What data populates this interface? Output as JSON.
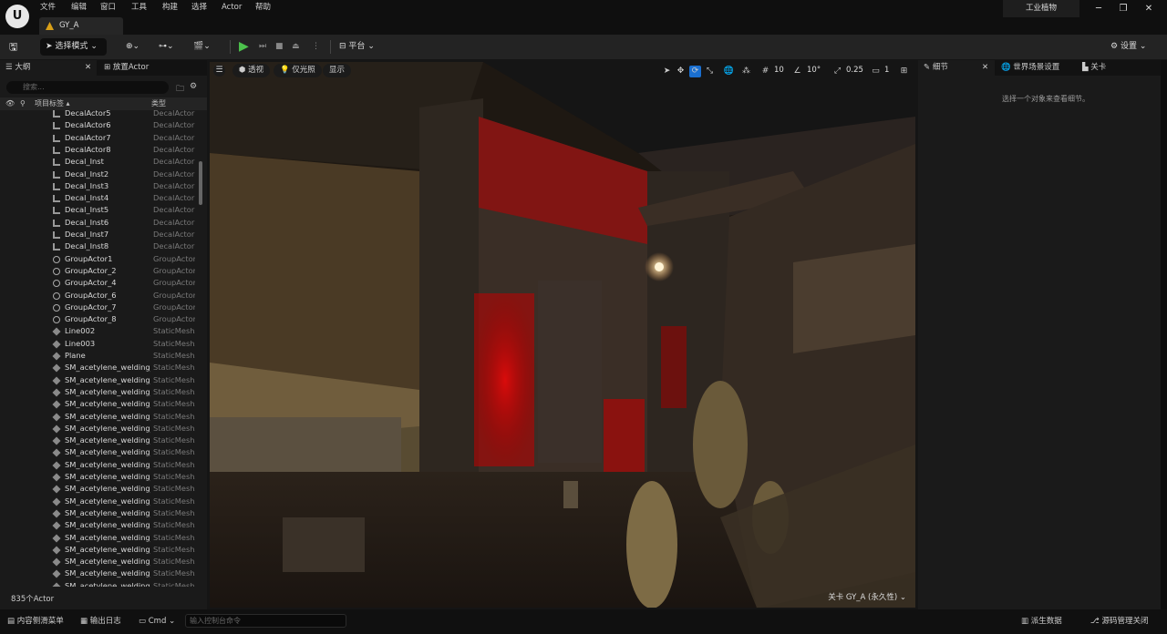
{
  "menu": [
    "文件",
    "编辑",
    "窗口",
    "工具",
    "构建",
    "选择",
    "Actor",
    "帮助"
  ],
  "project_name": "工业植物",
  "document_tab": "GY_A",
  "toolbar": {
    "mode_label": "选择模式",
    "platform_label": "平台",
    "settings_label": "设置"
  },
  "outliner": {
    "tab_label": "大纲",
    "place_actor_label": "放置Actor",
    "search_placeholder": "搜索...",
    "col_label": "项目标签",
    "col_type": "类型",
    "count": "835个Actor",
    "rows": [
      {
        "name": "DecalActor5",
        "type": "DecalActor",
        "icon": "decal"
      },
      {
        "name": "DecalActor6",
        "type": "DecalActor",
        "icon": "decal"
      },
      {
        "name": "DecalActor7",
        "type": "DecalActor",
        "icon": "decal"
      },
      {
        "name": "DecalActor8",
        "type": "DecalActor",
        "icon": "decal"
      },
      {
        "name": "Decal_Inst",
        "type": "DecalActor",
        "icon": "decal"
      },
      {
        "name": "Decal_Inst2",
        "type": "DecalActor",
        "icon": "decal"
      },
      {
        "name": "Decal_Inst3",
        "type": "DecalActor",
        "icon": "decal"
      },
      {
        "name": "Decal_Inst4",
        "type": "DecalActor",
        "icon": "decal"
      },
      {
        "name": "Decal_Inst5",
        "type": "DecalActor",
        "icon": "decal"
      },
      {
        "name": "Decal_Inst6",
        "type": "DecalActor",
        "icon": "decal"
      },
      {
        "name": "Decal_Inst7",
        "type": "DecalActor",
        "icon": "decal"
      },
      {
        "name": "Decal_Inst8",
        "type": "DecalActor",
        "icon": "decal"
      },
      {
        "name": "GroupActor1",
        "type": "GroupActor",
        "icon": "group"
      },
      {
        "name": "GroupActor_2",
        "type": "GroupActor",
        "icon": "group"
      },
      {
        "name": "GroupActor_4",
        "type": "GroupActor",
        "icon": "group"
      },
      {
        "name": "GroupActor_6",
        "type": "GroupActor",
        "icon": "group"
      },
      {
        "name": "GroupActor_7",
        "type": "GroupActor",
        "icon": "group"
      },
      {
        "name": "GroupActor_8",
        "type": "GroupActor",
        "icon": "group"
      },
      {
        "name": "Line002",
        "type": "StaticMeshA",
        "icon": "mesh"
      },
      {
        "name": "Line003",
        "type": "StaticMeshA",
        "icon": "mesh"
      },
      {
        "name": "Plane",
        "type": "StaticMeshA",
        "icon": "mesh"
      },
      {
        "name": "SM_acetylene_welding_",
        "type": "StaticMeshA",
        "icon": "mesh"
      },
      {
        "name": "SM_acetylene_welding_",
        "type": "StaticMeshA",
        "icon": "mesh"
      },
      {
        "name": "SM_acetylene_welding_",
        "type": "StaticMeshA",
        "icon": "mesh"
      },
      {
        "name": "SM_acetylene_welding_",
        "type": "StaticMeshA",
        "icon": "mesh"
      },
      {
        "name": "SM_acetylene_welding_",
        "type": "StaticMeshA",
        "icon": "mesh"
      },
      {
        "name": "SM_acetylene_welding_",
        "type": "StaticMeshA",
        "icon": "mesh"
      },
      {
        "name": "SM_acetylene_welding_",
        "type": "StaticMeshA",
        "icon": "mesh"
      },
      {
        "name": "SM_acetylene_welding_",
        "type": "StaticMeshA",
        "icon": "mesh"
      },
      {
        "name": "SM_acetylene_welding_",
        "type": "StaticMeshA",
        "icon": "mesh"
      },
      {
        "name": "SM_acetylene_welding_",
        "type": "StaticMeshA",
        "icon": "mesh"
      },
      {
        "name": "SM_acetylene_welding_",
        "type": "StaticMeshA",
        "icon": "mesh"
      },
      {
        "name": "SM_acetylene_welding_",
        "type": "StaticMeshA",
        "icon": "mesh"
      },
      {
        "name": "SM_acetylene_welding_",
        "type": "StaticMeshA",
        "icon": "mesh"
      },
      {
        "name": "SM_acetylene_welding_",
        "type": "StaticMeshA",
        "icon": "mesh"
      },
      {
        "name": "SM_acetylene_welding_",
        "type": "StaticMeshA",
        "icon": "mesh"
      },
      {
        "name": "SM_acetylene_welding_",
        "type": "StaticMeshA",
        "icon": "mesh"
      },
      {
        "name": "SM_acetylene_welding_",
        "type": "StaticMeshA",
        "icon": "mesh"
      },
      {
        "name": "SM_acetylene_welding_",
        "type": "StaticMeshA",
        "icon": "mesh"
      },
      {
        "name": "SM_acetylene_welding_",
        "type": "StaticMeshA",
        "icon": "mesh"
      }
    ]
  },
  "viewport": {
    "perspective_label": "透视",
    "lighting_label": "仅光照",
    "show_label": "显示",
    "grid_snap": "10",
    "rot_snap": "10°",
    "scale_snap": "0.25",
    "camera_speed": "1",
    "level_prefix": "关卡",
    "level_name": "GY_A (永久性)"
  },
  "details": {
    "tab_details": "细节",
    "tab_world": "世界场景设置",
    "tab_level": "关卡",
    "hint": "选择一个对象来查看细节。"
  },
  "statusbar": {
    "content_drawer": "内容侧滑菜单",
    "output_log": "输出日志",
    "cmd_label": "Cmd",
    "cmd_placeholder": "输入控制台命令",
    "derived_data": "派生数据",
    "source_control": "源码管理关闭"
  }
}
